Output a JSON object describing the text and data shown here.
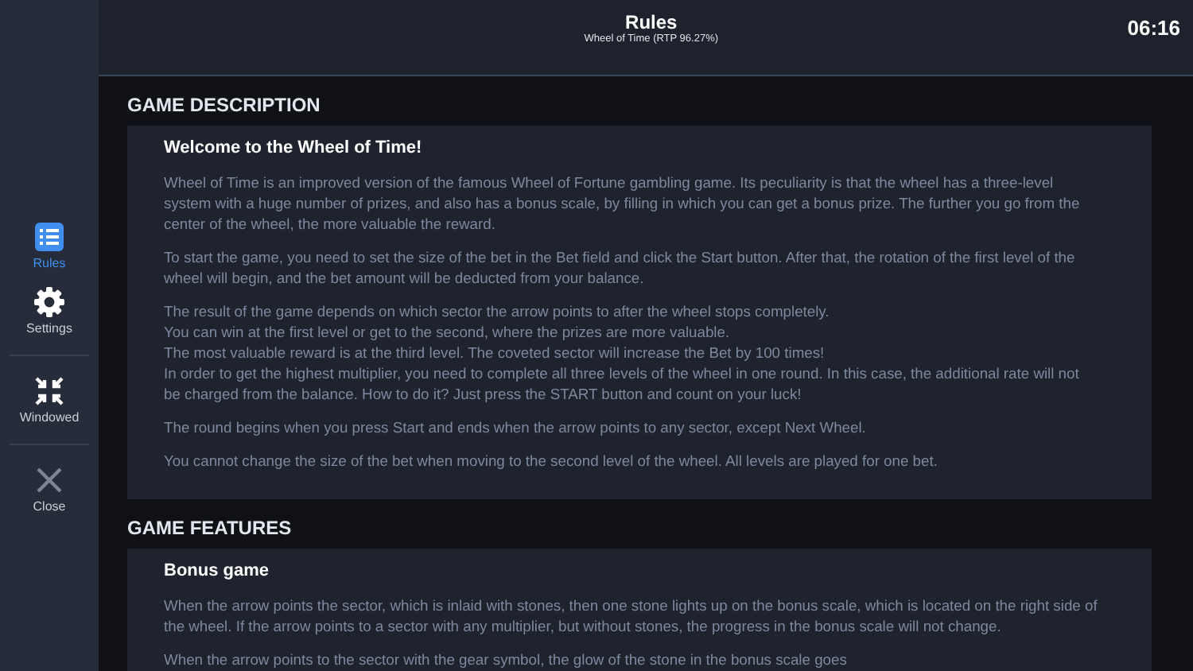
{
  "header": {
    "title": "Rules",
    "subtitle": "Wheel of Time (RTP 96.27%)",
    "time": "06:16"
  },
  "sidebar": {
    "groups": [
      [
        {
          "kind": "rules",
          "label": "Rules",
          "selected": true
        },
        {
          "kind": "settings",
          "label": "Settings",
          "selected": false
        }
      ],
      [
        {
          "kind": "windowed",
          "label": "Windowed",
          "selected": false
        }
      ],
      [
        {
          "kind": "close",
          "label": "Close",
          "selected": false
        }
      ]
    ]
  },
  "sections": [
    {
      "heading": "GAME DESCRIPTION",
      "blocks": [
        {
          "title": "Welcome to the Wheel of Time!",
          "paragraphs": [
            {
              "lines": [
                "Wheel of Time is an improved version of the famous Wheel of Fortune gambling game. Its peculiarity is that the wheel has a three-level system with a huge number of prizes, and also has a bonus scale, by filling in which you can get a bonus prize. The further you go from the center of the wheel, the more valuable the reward."
              ]
            },
            {
              "lines": [
                "To start the game, you need to set the size of the bet in the Bet field and click the Start button. After that, the rotation of the first level of the wheel will begin, and the bet amount will be deducted from your balance."
              ]
            },
            {
              "lines": [
                "The result of the game depends on which sector the arrow points to after the wheel stops completely.",
                "You can win at the first level or get to the second, where the prizes are more valuable.",
                "The most valuable reward is at the third level. The coveted sector will increase the Bet by 100 times!",
                "In order to get the highest multiplier, you need to complete all three levels of the wheel in one round. In this case, the additional rate will not be charged from the balance. How to do it? Just press the START button and count on your luck!"
              ]
            },
            {
              "lines": [
                "The round begins when you press Start and ends when the arrow points to any sector, except Next Wheel."
              ]
            },
            {
              "lines": [
                "You cannot change the size of the bet when moving to the second level of the wheel. All levels are played for one bet."
              ]
            }
          ]
        }
      ]
    },
    {
      "heading": "GAME FEATURES",
      "blocks": [
        {
          "title": "Bonus game",
          "paragraphs": [
            {
              "lines": [
                "When the arrow points the sector, which is inlaid with stones, then one stone lights up on the bonus scale, which is located on the right side of the wheel. If the arrow points to a sector with any multiplier, but without stones, the progress in the bonus scale will not change."
              ]
            },
            {
              "lines": [
                "When the arrow points to the sector with the gear symbol, the glow of the stone in the bonus scale goes"
              ]
            }
          ]
        }
      ]
    }
  ]
}
